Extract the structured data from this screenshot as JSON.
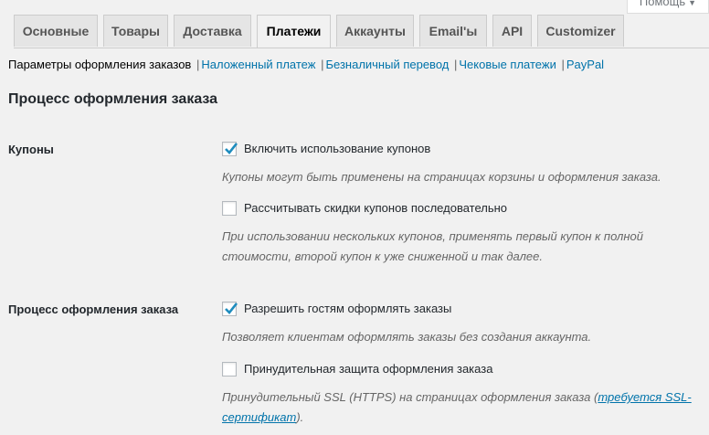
{
  "help": {
    "label": "Помощь"
  },
  "tabs": [
    {
      "label": "Основные"
    },
    {
      "label": "Товары"
    },
    {
      "label": "Доставка"
    },
    {
      "label": "Платежи",
      "active": true
    },
    {
      "label": "Аккаунты"
    },
    {
      "label": "Email'ы"
    },
    {
      "label": "API"
    },
    {
      "label": "Customizer"
    }
  ],
  "subnav": {
    "current": "Параметры оформления заказов",
    "links": [
      "Наложенный платеж",
      "Безналичный перевод",
      "Чековые платежи",
      "PayPal"
    ],
    "separator": "|"
  },
  "section": {
    "title": "Процесс оформления заказа"
  },
  "coupons": {
    "label": "Купоны",
    "enable": {
      "label": "Включить использование купонов",
      "checked": true
    },
    "enable_desc": "Купоны могут быть применены на страницах корзины и оформления заказа.",
    "sequential": {
      "label": "Рассчитывать скидки купонов последовательно",
      "checked": false
    },
    "sequential_desc_1": "При использовании нескольких купонов, применять первый купон к полной",
    "sequential_desc_2": "стоимости, второй купон к уже сниженной и так далее."
  },
  "checkout": {
    "label": "Процесс оформления заказа",
    "guest": {
      "label": "Разрешить гостям оформлять заказы",
      "checked": true
    },
    "guest_desc": "Позволяет клиентам оформлять заказы без создания аккаунта.",
    "ssl": {
      "label": "Принудительная защита оформления заказа",
      "checked": false
    },
    "ssl_desc_before": "Принудительный SSL (HTTPS) на страницах оформления заказа (",
    "ssl_desc_link_1": "требуется SSL-",
    "ssl_desc_link_2": "сертификат",
    "ssl_desc_after": ")."
  },
  "colors": {
    "accent": "#0073aa",
    "checkmark": "#1e8cbe",
    "background": "#f1f1f1"
  }
}
